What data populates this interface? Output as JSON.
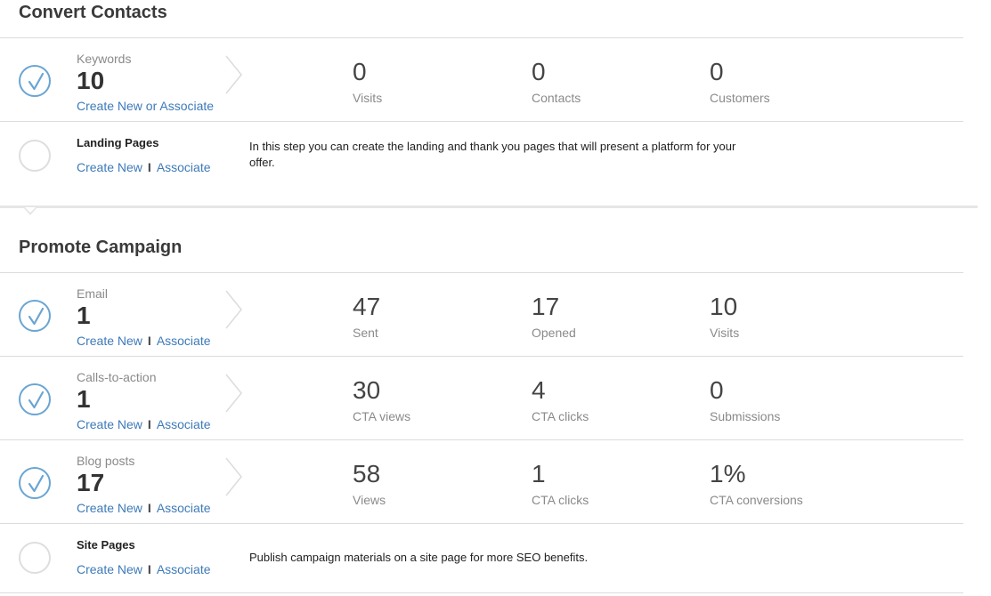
{
  "sections": {
    "convert": {
      "title": "Convert Contacts",
      "keywords": {
        "label": "Keywords",
        "count": "10",
        "link": "Create New or Associate",
        "metrics": [
          {
            "value": "0",
            "label": "Visits"
          },
          {
            "value": "0",
            "label": "Contacts"
          },
          {
            "value": "0",
            "label": "Customers"
          }
        ]
      },
      "landing": {
        "label": "Landing Pages",
        "create": "Create New",
        "separator": "I",
        "associate": "Associate",
        "description": "In this step you can create the landing and thank you pages that will present a platform for your offer."
      }
    },
    "promote": {
      "title": "Promote Campaign",
      "email": {
        "label": "Email",
        "count": "1",
        "create": "Create New",
        "separator": "I",
        "associate": "Associate",
        "metrics": [
          {
            "value": "47",
            "label": "Sent"
          },
          {
            "value": "17",
            "label": "Opened"
          },
          {
            "value": "10",
            "label": "Visits"
          }
        ]
      },
      "cta": {
        "label": "Calls-to-action",
        "count": "1",
        "create": "Create New",
        "separator": "I",
        "associate": "Associate",
        "metrics": [
          {
            "value": "30",
            "label": "CTA views"
          },
          {
            "value": "4",
            "label": "CTA clicks"
          },
          {
            "value": "0",
            "label": "Submissions"
          }
        ]
      },
      "blog": {
        "label": "Blog posts",
        "count": "17",
        "create": "Create New",
        "separator": "I",
        "associate": "Associate",
        "metrics": [
          {
            "value": "58",
            "label": "Views"
          },
          {
            "value": "1",
            "label": "CTA clicks"
          },
          {
            "value": "1%",
            "label": "CTA conversions"
          }
        ]
      },
      "site": {
        "label": "Site Pages",
        "create": "Create New",
        "separator": "I",
        "associate": "Associate",
        "description": "Publish campaign materials on a site page for more SEO benefits."
      }
    }
  },
  "colors": {
    "link": "#3d7ab8",
    "check_circle": "#6aa5d3",
    "empty_circle": "#dedede"
  },
  "icons": {
    "complete": "check-circle-icon",
    "incomplete": "empty-circle-icon",
    "row_arrow": "chevron-right-icon"
  }
}
